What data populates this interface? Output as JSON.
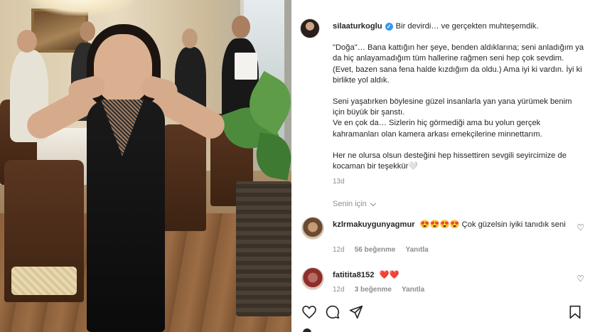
{
  "post": {
    "username": "silaaturkoglu",
    "lead": "Bir devirdi… ve gerçekten muhteşemdik.",
    "paragraphs": [
      "\"Doğa\"… Bana kattığın her şeye, benden aldıklarına; seni anladığım ya da hiç anlayamadığım tüm hallerine rağmen seni hep çok sevdim. (Evet, bazen sana fena halde kızdığım da oldu.) Ama iyi ki vardın. İyi ki birlikte yol aldık.",
      "Seni yaşatırken böylesine güzel insanlarla yan yana yürümek benim için büyük bir şanstı.\nVe en çok da… Sizlerin hiç görmediği ama bu yolun gerçek kahramanları olan kamera arkası emekçilerine minnettarım.",
      "Her ne olursa olsun desteğini hep hissettiren sevgili seyircimize de kocaman bir teşekkür🤍"
    ],
    "time": "13d",
    "for_you": "Senin için"
  },
  "comments": [
    {
      "username": "kzlrmakuygunyagmur",
      "text": "😍😍😍😍 Çok güzelsin iyiki tanıdık seni",
      "time": "12d",
      "likes": "56 beğenme",
      "reply": "Yanıtla"
    },
    {
      "username": "fatitita8152",
      "text": "❤️❤️",
      "time": "12d",
      "likes": "3 beğenme",
      "reply": "Yanıtla"
    }
  ],
  "icons": {
    "like": "heart-icon",
    "comment": "comment-icon",
    "share": "send-icon",
    "save": "bookmark-icon",
    "verified": "verified-badge-icon",
    "comment_like": "heart-outline-icon"
  }
}
